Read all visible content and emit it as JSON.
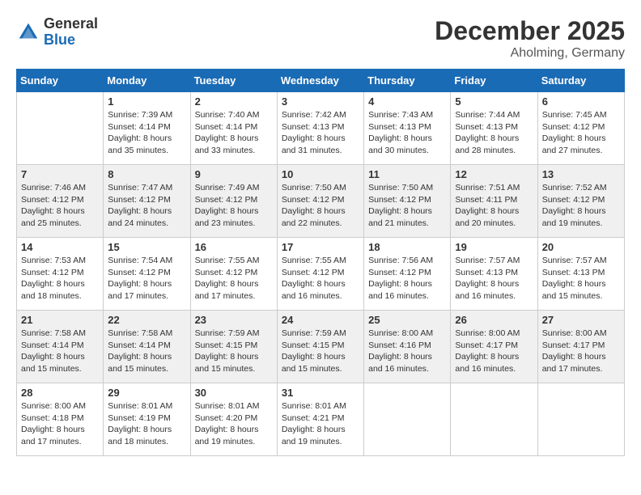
{
  "header": {
    "logo_general": "General",
    "logo_blue": "Blue",
    "month_title": "December 2025",
    "location": "Aholming, Germany"
  },
  "days_of_week": [
    "Sunday",
    "Monday",
    "Tuesday",
    "Wednesday",
    "Thursday",
    "Friday",
    "Saturday"
  ],
  "weeks": [
    [
      {
        "day": "",
        "info": ""
      },
      {
        "day": "1",
        "info": "Sunrise: 7:39 AM\nSunset: 4:14 PM\nDaylight: 8 hours\nand 35 minutes."
      },
      {
        "day": "2",
        "info": "Sunrise: 7:40 AM\nSunset: 4:14 PM\nDaylight: 8 hours\nand 33 minutes."
      },
      {
        "day": "3",
        "info": "Sunrise: 7:42 AM\nSunset: 4:13 PM\nDaylight: 8 hours\nand 31 minutes."
      },
      {
        "day": "4",
        "info": "Sunrise: 7:43 AM\nSunset: 4:13 PM\nDaylight: 8 hours\nand 30 minutes."
      },
      {
        "day": "5",
        "info": "Sunrise: 7:44 AM\nSunset: 4:13 PM\nDaylight: 8 hours\nand 28 minutes."
      },
      {
        "day": "6",
        "info": "Sunrise: 7:45 AM\nSunset: 4:12 PM\nDaylight: 8 hours\nand 27 minutes."
      }
    ],
    [
      {
        "day": "7",
        "info": "Sunrise: 7:46 AM\nSunset: 4:12 PM\nDaylight: 8 hours\nand 25 minutes."
      },
      {
        "day": "8",
        "info": "Sunrise: 7:47 AM\nSunset: 4:12 PM\nDaylight: 8 hours\nand 24 minutes."
      },
      {
        "day": "9",
        "info": "Sunrise: 7:49 AM\nSunset: 4:12 PM\nDaylight: 8 hours\nand 23 minutes."
      },
      {
        "day": "10",
        "info": "Sunrise: 7:50 AM\nSunset: 4:12 PM\nDaylight: 8 hours\nand 22 minutes."
      },
      {
        "day": "11",
        "info": "Sunrise: 7:50 AM\nSunset: 4:12 PM\nDaylight: 8 hours\nand 21 minutes."
      },
      {
        "day": "12",
        "info": "Sunrise: 7:51 AM\nSunset: 4:11 PM\nDaylight: 8 hours\nand 20 minutes."
      },
      {
        "day": "13",
        "info": "Sunrise: 7:52 AM\nSunset: 4:12 PM\nDaylight: 8 hours\nand 19 minutes."
      }
    ],
    [
      {
        "day": "14",
        "info": "Sunrise: 7:53 AM\nSunset: 4:12 PM\nDaylight: 8 hours\nand 18 minutes."
      },
      {
        "day": "15",
        "info": "Sunrise: 7:54 AM\nSunset: 4:12 PM\nDaylight: 8 hours\nand 17 minutes."
      },
      {
        "day": "16",
        "info": "Sunrise: 7:55 AM\nSunset: 4:12 PM\nDaylight: 8 hours\nand 17 minutes."
      },
      {
        "day": "17",
        "info": "Sunrise: 7:55 AM\nSunset: 4:12 PM\nDaylight: 8 hours\nand 16 minutes."
      },
      {
        "day": "18",
        "info": "Sunrise: 7:56 AM\nSunset: 4:12 PM\nDaylight: 8 hours\nand 16 minutes."
      },
      {
        "day": "19",
        "info": "Sunrise: 7:57 AM\nSunset: 4:13 PM\nDaylight: 8 hours\nand 16 minutes."
      },
      {
        "day": "20",
        "info": "Sunrise: 7:57 AM\nSunset: 4:13 PM\nDaylight: 8 hours\nand 15 minutes."
      }
    ],
    [
      {
        "day": "21",
        "info": "Sunrise: 7:58 AM\nSunset: 4:14 PM\nDaylight: 8 hours\nand 15 minutes."
      },
      {
        "day": "22",
        "info": "Sunrise: 7:58 AM\nSunset: 4:14 PM\nDaylight: 8 hours\nand 15 minutes."
      },
      {
        "day": "23",
        "info": "Sunrise: 7:59 AM\nSunset: 4:15 PM\nDaylight: 8 hours\nand 15 minutes."
      },
      {
        "day": "24",
        "info": "Sunrise: 7:59 AM\nSunset: 4:15 PM\nDaylight: 8 hours\nand 15 minutes."
      },
      {
        "day": "25",
        "info": "Sunrise: 8:00 AM\nSunset: 4:16 PM\nDaylight: 8 hours\nand 16 minutes."
      },
      {
        "day": "26",
        "info": "Sunrise: 8:00 AM\nSunset: 4:17 PM\nDaylight: 8 hours\nand 16 minutes."
      },
      {
        "day": "27",
        "info": "Sunrise: 8:00 AM\nSunset: 4:17 PM\nDaylight: 8 hours\nand 17 minutes."
      }
    ],
    [
      {
        "day": "28",
        "info": "Sunrise: 8:00 AM\nSunset: 4:18 PM\nDaylight: 8 hours\nand 17 minutes."
      },
      {
        "day": "29",
        "info": "Sunrise: 8:01 AM\nSunset: 4:19 PM\nDaylight: 8 hours\nand 18 minutes."
      },
      {
        "day": "30",
        "info": "Sunrise: 8:01 AM\nSunset: 4:20 PM\nDaylight: 8 hours\nand 19 minutes."
      },
      {
        "day": "31",
        "info": "Sunrise: 8:01 AM\nSunset: 4:21 PM\nDaylight: 8 hours\nand 19 minutes."
      },
      {
        "day": "",
        "info": ""
      },
      {
        "day": "",
        "info": ""
      },
      {
        "day": "",
        "info": ""
      }
    ]
  ]
}
